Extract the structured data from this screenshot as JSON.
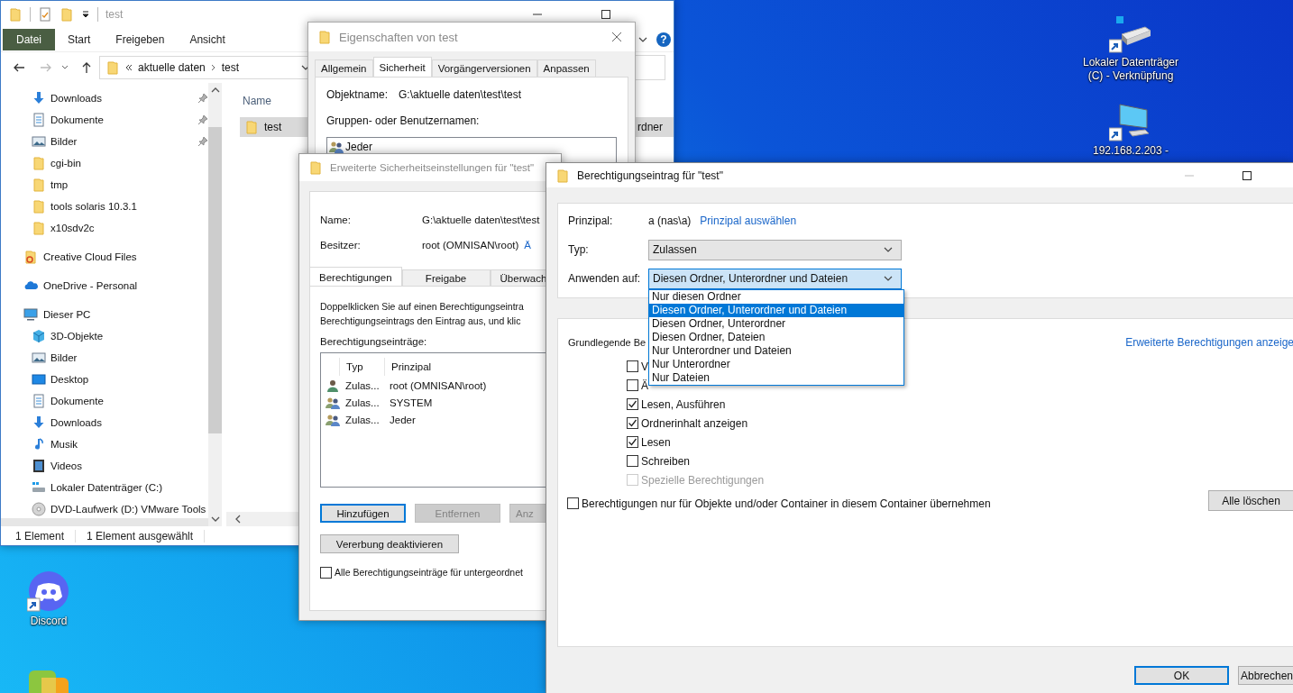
{
  "desktop_icons": [
    {
      "kind": "drive",
      "label": "Lokaler Datenträger (C) - Verknüpfung"
    },
    {
      "kind": "monitor",
      "label": "192.168.2.203 -"
    },
    {
      "kind": "discord",
      "label": "Discord"
    },
    {
      "kind": "vmware"
    }
  ],
  "explorer": {
    "title": "test",
    "ribbon_tabs": [
      {
        "kind": "file",
        "label": "Datei"
      },
      {
        "kind": "tab",
        "label": "Start"
      },
      {
        "kind": "tab",
        "label": "Freigeben"
      },
      {
        "kind": "tab",
        "label": "Ansicht"
      }
    ],
    "help": "?",
    "address": [
      "aktuelle daten",
      "test"
    ],
    "nav_items": [
      {
        "children": [
          {
            "label": "Downloads",
            "kind": "download",
            "pinned": true
          },
          {
            "label": "Dokumente",
            "kind": "document",
            "pinned": true
          },
          {
            "label": "Bilder",
            "kind": "pictures",
            "pinned": true
          },
          {
            "label": "cgi-bin",
            "kind": "folder",
            "pinned": false
          },
          {
            "label": "tmp",
            "kind": "folder",
            "pinned": false
          },
          {
            "label": "tools solaris 10.3.1",
            "kind": "folder",
            "pinned": false
          },
          {
            "label": "x10sdv2c",
            "kind": "folder",
            "pinned": false
          }
        ]
      },
      {
        "label": "Creative Cloud Files",
        "kind": "creative-cloud"
      },
      {
        "label": "OneDrive - Personal",
        "kind": "onedrive"
      },
      {
        "label": "Dieser PC",
        "kind": "pc",
        "children": [
          {
            "label": "3D-Objekte",
            "kind": "objects"
          },
          {
            "label": "Bilder",
            "kind": "pictures"
          },
          {
            "label": "Desktop",
            "kind": "desktop"
          },
          {
            "label": "Dokumente",
            "kind": "document"
          },
          {
            "label": "Downloads",
            "kind": "download"
          },
          {
            "label": "Musik",
            "kind": "music"
          },
          {
            "label": "Videos",
            "kind": "video"
          },
          {
            "label": "Lokaler Datenträger (C:)",
            "kind": "drive"
          },
          {
            "label": "DVD-Laufwerk (D:) VMware Tools",
            "kind": "dvd"
          }
        ]
      }
    ],
    "columns": [
      "Name"
    ],
    "rows": [
      {
        "name": "test",
        "type": "rdner",
        "selected": true
      }
    ],
    "status": [
      "1 Element",
      "1 Element ausgewählt"
    ]
  },
  "properties": {
    "title": "Eigenschaften von test",
    "tabs": [
      {
        "label": "Allgemein",
        "selected": false
      },
      {
        "label": "Sicherheit",
        "selected": true
      },
      {
        "label": "Vorgängerversionen",
        "selected": false
      },
      {
        "label": "Anpassen",
        "selected": false
      }
    ],
    "object_label": "Objektname:",
    "object_value": "G:\\aktuelle daten\\test\\test",
    "groups_label": "Gruppen- oder Benutzernamen:",
    "principals": [
      {
        "name": "Jeder",
        "kind": "group"
      }
    ]
  },
  "advanced": {
    "title": "Erweiterte Sicherheitseinstellungen für \"test\"",
    "name_label": "Name:",
    "name_value": "G:\\aktuelle daten\\test\\test",
    "owner_label": "Besitzer:",
    "owner_value": "root (OMNISAN\\root)",
    "owner_link": "Ä",
    "tabs": [
      {
        "label": "Berechtigungen",
        "selected": true
      },
      {
        "label": "Freigabe",
        "selected": false
      },
      {
        "label": "Überwach",
        "selected": false
      }
    ],
    "description": [
      "Doppelklicken Sie auf einen Berechtigungseintra",
      "Berechtigungseintrags den Eintrag aus, und klic"
    ],
    "entries_label": "Berechtigungseinträge:",
    "columns": [
      "Typ",
      "Prinzipal"
    ],
    "entries": [
      {
        "kind": "user",
        "type": "Zulas...",
        "principal": "root (OMNISAN\\root)"
      },
      {
        "kind": "group",
        "type": "Zulas...",
        "principal": "SYSTEM"
      },
      {
        "kind": "group",
        "type": "Zulas...",
        "principal": "Jeder"
      }
    ],
    "buttons": [
      {
        "label": "Hinzufügen",
        "disabled": false,
        "focused": true
      },
      {
        "label": "Entfernen",
        "disabled": true,
        "focused": false
      },
      {
        "label": "Anz",
        "disabled": true,
        "focused": false
      }
    ],
    "inherit_button": "Vererbung deaktivieren",
    "replace_checkbox": {
      "label": "Alle Berechtigungseinträge für untergeordnet",
      "checked": false
    }
  },
  "entry": {
    "title": "Berechtigungseintrag für \"test\"",
    "principal_label": "Prinzipal:",
    "principal_value": "a (nas\\a)",
    "principal_link": "Prinzipal auswählen",
    "type_label": "Typ:",
    "type_value": "Zulassen",
    "apply_label": "Anwenden auf:",
    "apply_value": "Diesen Ordner, Unterordner und Dateien",
    "apply_options": [
      {
        "label": "Nur diesen Ordner",
        "selected": false
      },
      {
        "label": "Diesen Ordner, Unterordner und Dateien",
        "selected": true
      },
      {
        "label": "Diesen Ordner, Unterordner",
        "selected": false
      },
      {
        "label": "Diesen Ordner, Dateien",
        "selected": false
      },
      {
        "label": "Nur Unterordner und Dateien",
        "selected": false
      },
      {
        "label": "Nur Unterordner",
        "selected": false
      },
      {
        "label": "Nur Dateien",
        "selected": false
      }
    ],
    "basic_label": "Grundlegende Be",
    "advanced_link": "Erweiterte Berechtigungen anzeige",
    "permissions": [
      {
        "label": "V",
        "checked": false,
        "disabled": false
      },
      {
        "label": "Ä",
        "checked": false,
        "disabled": false
      },
      {
        "label": "Lesen, Ausführen",
        "checked": true,
        "disabled": false
      },
      {
        "label": "Ordnerinhalt anzeigen",
        "checked": true,
        "disabled": false
      },
      {
        "label": "Lesen",
        "checked": true,
        "disabled": false
      },
      {
        "label": "Schreiben",
        "checked": false,
        "disabled": false
      },
      {
        "label": "Spezielle Berechtigungen",
        "checked": false,
        "disabled": true
      }
    ],
    "only_checkbox": {
      "label": "Berechtigungen nur für Objekte und/oder Container in diesem Container übernehmen",
      "checked": false
    },
    "clear_button": "Alle löschen",
    "buttons": [
      {
        "label": "OK",
        "focused": true
      },
      {
        "label": "Abbrechen",
        "focused": false
      }
    ]
  }
}
